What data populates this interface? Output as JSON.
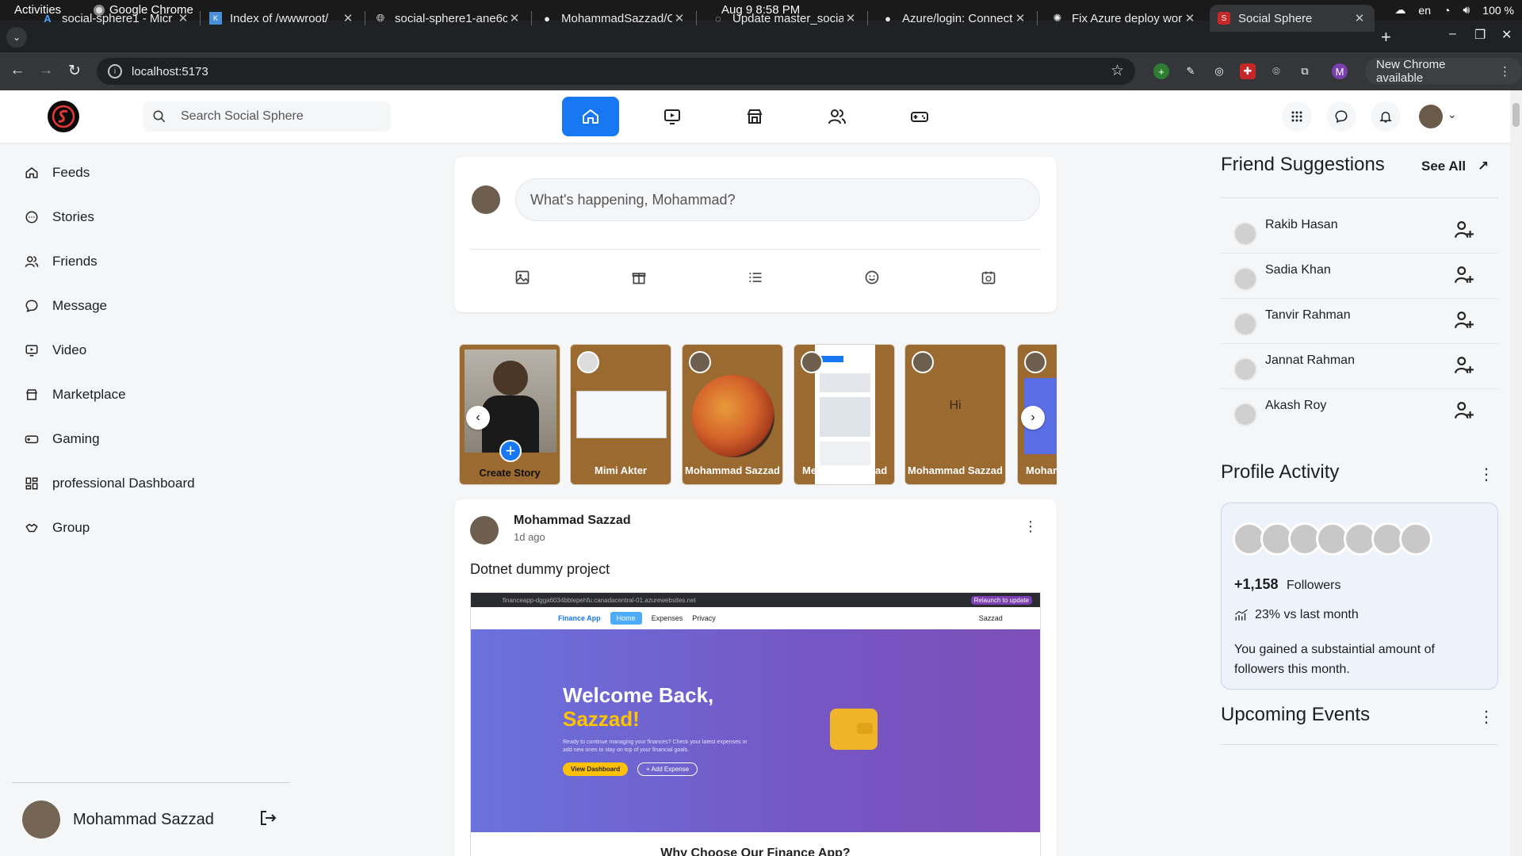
{
  "system": {
    "activities": "Activities",
    "app_name": "Google Chrome",
    "clock": "Aug 9  8:58 PM",
    "lang": "en",
    "battery": "100 %"
  },
  "browser": {
    "tabs": [
      {
        "title": "social-sphere1 - Micr",
        "icon": "azure-icon"
      },
      {
        "title": "Index of /wwwroot/",
        "icon": "kudu-icon"
      },
      {
        "title": "social-sphere1-ane6c",
        "icon": "globe-icon"
      },
      {
        "title": "MohammadSazzad/C",
        "icon": "github-icon"
      },
      {
        "title": "Update master_socia",
        "icon": "loading-icon"
      },
      {
        "title": "Azure/login: Connect",
        "icon": "github-icon"
      },
      {
        "title": "Fix Azure deploy wor",
        "icon": "openai-icon"
      },
      {
        "title": "Social Sphere",
        "icon": "social-sphere-icon"
      }
    ],
    "url": "localhost:5173",
    "profile_initial": "M",
    "update_label": "New Chrome available"
  },
  "header": {
    "search_placeholder": "Search Social Sphere"
  },
  "sidebar": {
    "items": [
      {
        "label": "Feeds",
        "icon": "home-icon"
      },
      {
        "label": "Stories",
        "icon": "stories-icon"
      },
      {
        "label": "Friends",
        "icon": "friends-icon"
      },
      {
        "label": "Message",
        "icon": "message-icon"
      },
      {
        "label": "Video",
        "icon": "video-icon"
      },
      {
        "label": "Marketplace",
        "icon": "marketplace-icon"
      },
      {
        "label": "Gaming",
        "icon": "gaming-icon"
      },
      {
        "label": "professional Dashboard",
        "icon": "dashboard-icon"
      },
      {
        "label": "Group",
        "icon": "group-icon"
      }
    ],
    "user_name": "Mohammad Sazzad"
  },
  "composer": {
    "placeholder": "What's happening, Mohammad?"
  },
  "stories": [
    {
      "name": "Create Story"
    },
    {
      "name": "Mimi Akter"
    },
    {
      "name": "Mohammad Sazzad"
    },
    {
      "name": "Me",
      "name_tail": "ad"
    },
    {
      "name": "Mohammad Sazzad",
      "text": "Hi"
    },
    {
      "name": "Moham"
    }
  ],
  "post": {
    "author": "Mohammad Sazzad",
    "time": "1d ago",
    "text": "Dotnet dummy project",
    "screenshot": {
      "url_text": "financeapp-dgga6034bbtepehfu.canadacentral-01.azurewebsites.net",
      "relaunch": "Relaunch to update",
      "brand": "Finance App",
      "nav": [
        "Home",
        "Expenses",
        "Privacy"
      ],
      "user": "Sazzad",
      "welcome_line1": "Welcome Back,",
      "welcome_line2": "Sazzad!",
      "subtext": "Ready to continue managing your finances? Check your latest expenses or add new ones to stay on top of your financial goals.",
      "btn_dashboard": "View Dashboard",
      "btn_add": "+ Add Expense",
      "why": "Why Choose Our Finance App?"
    }
  },
  "right": {
    "suggestions_title": "Friend Suggestions",
    "see_all": "See All",
    "friends": [
      {
        "name": "Rakib Hasan"
      },
      {
        "name": "Sadia Khan"
      },
      {
        "name": "Tanvir Rahman"
      },
      {
        "name": "Jannat Rahman"
      },
      {
        "name": "Akash Roy"
      }
    ],
    "activity_title": "Profile Activity",
    "followers_count": "+1,158",
    "followers_label": "Followers",
    "trend_text": "23% vs last month",
    "gained_text": "You gained a substaintial amount of followers this month.",
    "events_title": "Upcoming Events"
  },
  "colors": {
    "accent": "#1877f2",
    "story_bg": "#9a6a30",
    "activity_card_bg": "#eef2fb"
  }
}
